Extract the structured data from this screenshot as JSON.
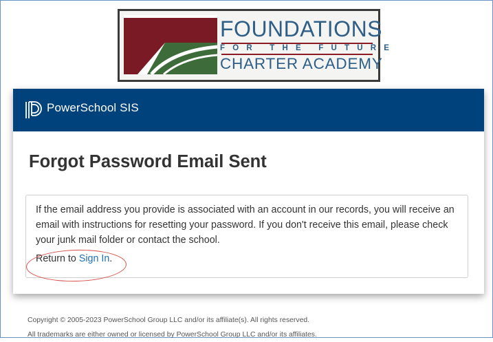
{
  "logo": {
    "line1": "FOUNDATIONS",
    "line2": "FOR THE FUTURE",
    "line3": "CHARTER ACADEMY"
  },
  "header": {
    "app_title": "PowerSchool SIS",
    "logo_icon": "powerschool-logo-icon"
  },
  "main": {
    "page_title": "Forgot Password Email Sent",
    "message": "If the email address you provide is associated with an account in our records, you will receive an email with instructions for resetting your password. If you don't receive this email, please check your junk mail folder or contact the school.",
    "return_prefix": "Return to ",
    "signin_link": "Sign In",
    "return_suffix": "."
  },
  "footer": {
    "copyright": "Copyright © 2005-2023 PowerSchool Group LLC and/or its affiliate(s). All rights reserved.",
    "trademarks": "All trademarks are either owned or licensed by PowerSchool Group LLC and/or its affiliates."
  },
  "colors": {
    "header_bg": "#00427c",
    "link": "#1f6fb5",
    "annotation_circle": "#d6504a",
    "logo_text": "#2f5e86",
    "logo_maroon": "#7a1a24",
    "logo_green": "#3e6b3a"
  }
}
